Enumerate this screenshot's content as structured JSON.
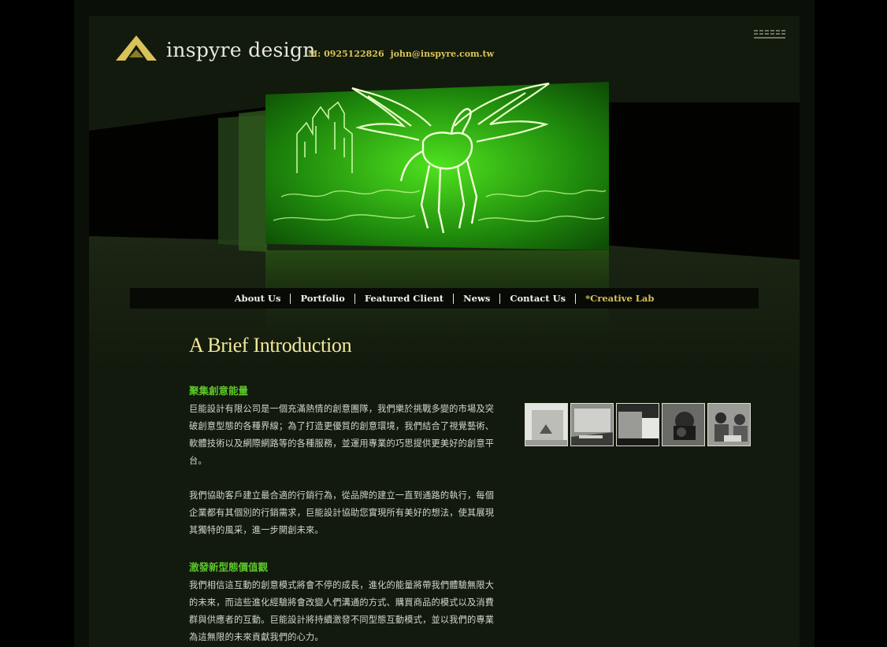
{
  "header": {
    "logo_text": "inspyre design",
    "phone": "M: 0925122826",
    "email": "john@inspyre.com.tw"
  },
  "nav": {
    "items": [
      "About Us",
      "Portfolio",
      "Featured Client",
      "News",
      "Contact Us",
      "*Creative Lab"
    ]
  },
  "intro": {
    "title": "A Brief Introduction"
  },
  "sections": [
    {
      "heading": "聚集創意能量",
      "paragraphs": [
        "巨能設計有限公司是一個充滿熱情的創意團隊，我們樂於挑戰多變的市場及突破創意型態的各種界線；為了打造更優質的創意環境，我們結合了視覺藝術、軟體技術以及網際網路等的各種服務，並運用專業的巧思提供更美好的創意平台。",
        "我們協助客戶建立最合適的行銷行為，從品牌的建立一直到通路的執行，每個企業都有其個別的行銷需求，巨能設計協助您實現所有美好的想法，使其展現其獨特的風采，進一步開創未來。"
      ]
    },
    {
      "heading": "激發新型態價值觀",
      "paragraphs": [
        "我們相信這互動的創意模式將會不停的成長，進化的能量將帶我們體驗無限大的未來，而這些進化經驗將會改變人們溝通的方式、購買商品的模式以及消費群與供應者的互動。巨能設計將持續激發不同型態互動模式，並以我們的專業為這無限的未來貢獻我們的心力。"
      ]
    }
  ],
  "colors": {
    "accent_gold": "#d8c35a",
    "heading_green": "#5cc72a",
    "hero_green": "#39d61a"
  }
}
